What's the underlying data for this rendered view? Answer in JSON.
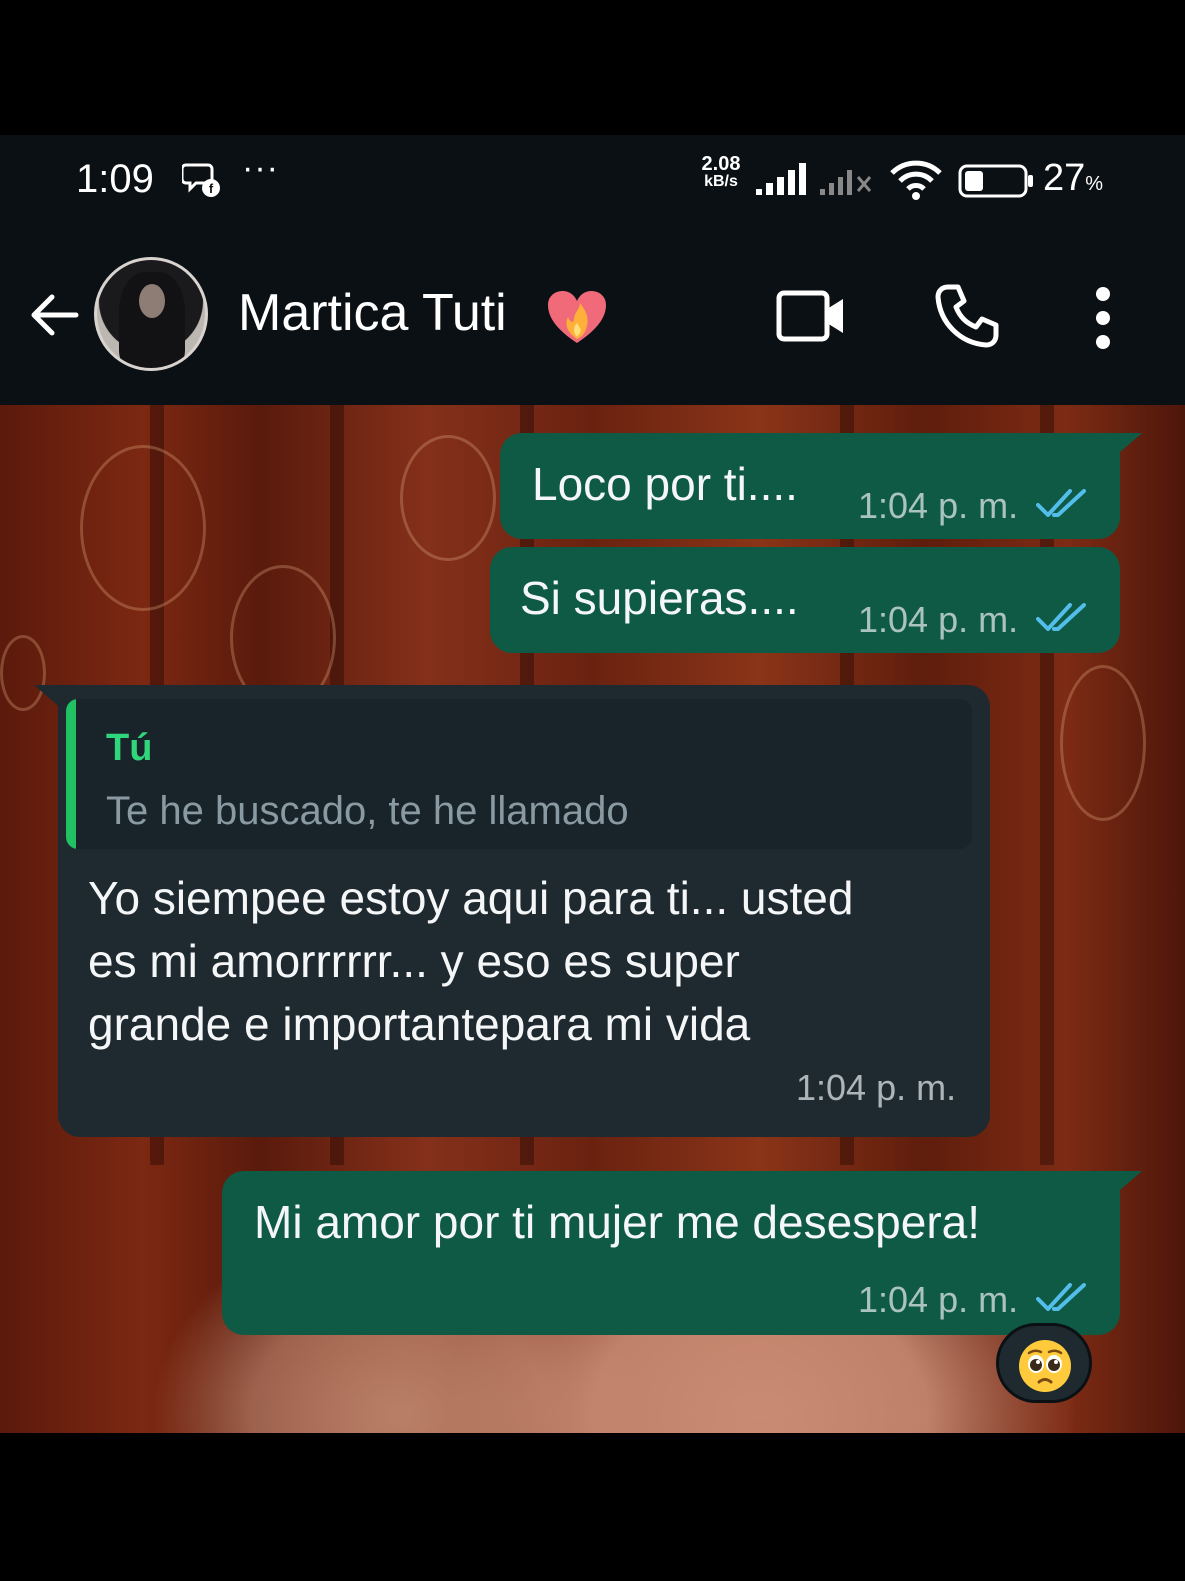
{
  "status_bar": {
    "time": "1:09",
    "net_speed_value": "2.08",
    "net_speed_unit": "kB/s",
    "battery_percent": "27",
    "battery_suffix": "%",
    "overflow_dots": "···"
  },
  "header": {
    "contact_name": "Martica Tuti",
    "icons": [
      "back-arrow-icon",
      "avatar",
      "heart-on-fire-icon",
      "video-call-icon",
      "phone-call-icon",
      "more-menu-icon"
    ]
  },
  "messages": [
    {
      "direction": "outgoing",
      "text": "Loco por ti....",
      "time": "1:04 p. m.",
      "status": "read"
    },
    {
      "direction": "outgoing",
      "text": "Si supieras....",
      "time": "1:04 p. m.",
      "status": "read"
    },
    {
      "direction": "incoming",
      "quote": {
        "author": "Tú",
        "text": "Te he buscado, te he llamado"
      },
      "lines": [
        "Yo siempee estoy aqui para ti... usted",
        "es mi amorrrrrr... y eso es super",
        "grande e importantepara mi vida"
      ],
      "time": "1:04 p. m."
    },
    {
      "direction": "outgoing",
      "text": "Mi amor por ti mujer me desespera!",
      "time": "1:04 p. m.",
      "status": "read",
      "reaction": "pleading-face-emoji"
    }
  ],
  "colors": {
    "outgoing_bubble": "#0f5a44",
    "incoming_bubble": "#1f2a30",
    "read_ticks": "#53bdeb",
    "quote_accent": "#21c063",
    "header_bg": "#0b1014"
  }
}
